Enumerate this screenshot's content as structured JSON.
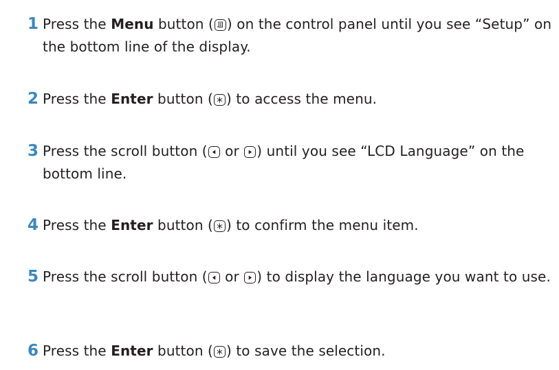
{
  "steps": [
    {
      "number": "1",
      "before": "Press the ",
      "bold": "Menu",
      "after_button_open": " button (",
      "after": ") on the control panel until you see “Setup” on the bottom line of the display.",
      "icon": "menu-button-icon"
    },
    {
      "number": "2",
      "before": "Press the ",
      "bold": "Enter",
      "after_button_open": " button (",
      "after": ") to access the menu.",
      "icon": "enter-button-icon"
    },
    {
      "number": "3",
      "before": "Press the scroll button (",
      "between": " or ",
      "after": ") until you see “LCD Language” on the bottom line.",
      "icons": [
        "scroll-left-button-icon",
        "scroll-right-button-icon"
      ]
    },
    {
      "number": "4",
      "before": "Press the ",
      "bold": "Enter",
      "after_button_open": " button (",
      "after": ") to confirm the menu item.",
      "icon": "enter-button-icon"
    },
    {
      "number": "5",
      "before": "Press the scroll button (",
      "between": " or ",
      "after": ") to display the language you want to use.",
      "icons": [
        "scroll-left-button-icon",
        "scroll-right-button-icon"
      ]
    },
    {
      "number": "6",
      "before": "Press the ",
      "bold": "Enter",
      "after_button_open": " button (",
      "after": ") to save the selection.",
      "icon": "enter-button-icon"
    }
  ],
  "colors": {
    "step_number": "#3c87bd",
    "text": "#231f20"
  }
}
